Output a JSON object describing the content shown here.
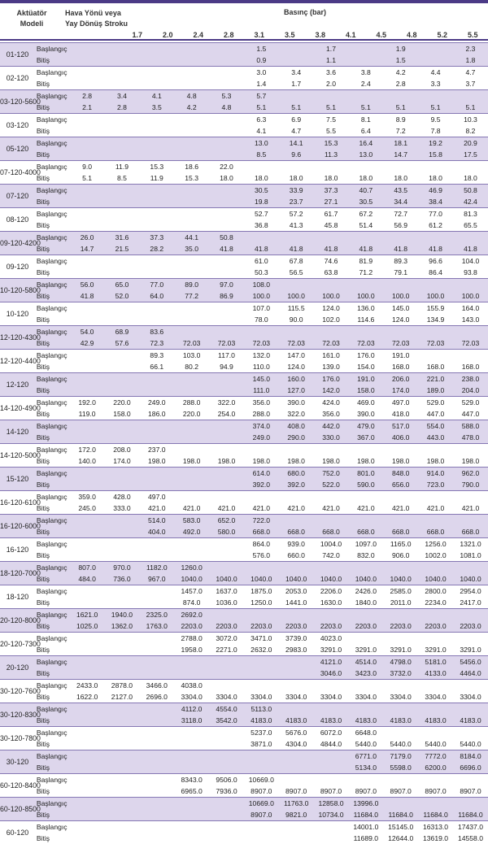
{
  "header": {
    "model_label_line1": "Aktüatör",
    "model_label_line2": "Modeli",
    "direction_line1": "Hava Yönü veya",
    "direction_line2": "Yay Dönüş Stroku",
    "pressure_label": "Basınç (bar)",
    "pressures": [
      "1.7",
      "2.0",
      "2.4",
      "2.8",
      "3.1",
      "3.5",
      "3.8",
      "4.1",
      "4.5",
      "4.8",
      "5.2",
      "5.5"
    ]
  },
  "start_label": "Başlangıç",
  "end_label": "Bitiş",
  "rows": [
    {
      "model": "01-120",
      "start": [
        "",
        "",
        "",
        "",
        "",
        "1.5",
        "",
        "1.7",
        "",
        "1.9",
        "",
        "2.3"
      ],
      "end": [
        "",
        "",
        "",
        "",
        "",
        "0.9",
        "",
        "1.1",
        "",
        "1.5",
        "",
        "1.8"
      ]
    },
    {
      "model": "02-120",
      "start": [
        "",
        "",
        "",
        "",
        "",
        "3.0",
        "3.4",
        "3.6",
        "3.8",
        "4.2",
        "4.4",
        "4.7"
      ],
      "end": [
        "",
        "",
        "",
        "",
        "",
        "1.4",
        "1.7",
        "2.0",
        "2.4",
        "2.8",
        "3.3",
        "3.7"
      ]
    },
    {
      "model": "03-120-5600",
      "start": [
        "2.8",
        "3.4",
        "4.1",
        "4.8",
        "5.3",
        "5.7",
        "",
        "",
        "",
        "",
        "",
        ""
      ],
      "end": [
        "2.1",
        "2.8",
        "3.5",
        "4.2",
        "4.8",
        "5.1",
        "5.1",
        "5.1",
        "5.1",
        "5.1",
        "5.1",
        "5.1"
      ]
    },
    {
      "model": "03-120",
      "start": [
        "",
        "",
        "",
        "",
        "",
        "6.3",
        "6.9",
        "7.5",
        "8.1",
        "8.9",
        "9.5",
        "10.3"
      ],
      "end": [
        "",
        "",
        "",
        "",
        "",
        "4.1",
        "4.7",
        "5.5",
        "6.4",
        "7.2",
        "7.8",
        "8.2"
      ]
    },
    {
      "model": "05-120",
      "start": [
        "",
        "",
        "",
        "",
        "",
        "13.0",
        "14.1",
        "15.3",
        "16.4",
        "18.1",
        "19.2",
        "20.9"
      ],
      "end": [
        "",
        "",
        "",
        "",
        "",
        "8.5",
        "9.6",
        "11.3",
        "13.0",
        "14.7",
        "15.8",
        "17.5"
      ]
    },
    {
      "model": "07-120-4000",
      "start": [
        "9.0",
        "11.9",
        "15.3",
        "18.6",
        "22.0",
        "",
        "",
        "",
        "",
        "",
        "",
        ""
      ],
      "end": [
        "5.1",
        "8.5",
        "11.9",
        "15.3",
        "18.0",
        "18.0",
        "18.0",
        "18.0",
        "18.0",
        "18.0",
        "18.0",
        "18.0"
      ]
    },
    {
      "model": "07-120",
      "start": [
        "",
        "",
        "",
        "",
        "",
        "30.5",
        "33.9",
        "37.3",
        "40.7",
        "43.5",
        "46.9",
        "50.8"
      ],
      "end": [
        "",
        "",
        "",
        "",
        "",
        "19.8",
        "23.7",
        "27.1",
        "30.5",
        "34.4",
        "38.4",
        "42.4"
      ]
    },
    {
      "model": "08-120",
      "start": [
        "",
        "",
        "",
        "",
        "",
        "52.7",
        "57.2",
        "61.7",
        "67.2",
        "72.7",
        "77.0",
        "81.3"
      ],
      "end": [
        "",
        "",
        "",
        "",
        "",
        "36.8",
        "41.3",
        "45.8",
        "51.4",
        "56.9",
        "61.2",
        "65.5"
      ]
    },
    {
      "model": "09-120-4200",
      "start": [
        "26.0",
        "31.6",
        "37.3",
        "44.1",
        "50.8",
        "",
        "",
        "",
        "",
        "",
        "",
        ""
      ],
      "end": [
        "14.7",
        "21.5",
        "28.2",
        "35.0",
        "41.8",
        "41.8",
        "41.8",
        "41.8",
        "41.8",
        "41.8",
        "41.8",
        "41.8"
      ]
    },
    {
      "model": "09-120",
      "start": [
        "",
        "",
        "",
        "",
        "",
        "61.0",
        "67.8",
        "74.6",
        "81.9",
        "89.3",
        "96.6",
        "104.0"
      ],
      "end": [
        "",
        "",
        "",
        "",
        "",
        "50.3",
        "56.5",
        "63.8",
        "71.2",
        "79.1",
        "86.4",
        "93.8"
      ]
    },
    {
      "model": "10-120-5800",
      "start": [
        "56.0",
        "65.0",
        "77.0",
        "89.0",
        "97.0",
        "108.0",
        "",
        "",
        "",
        "",
        "",
        ""
      ],
      "end": [
        "41.8",
        "52.0",
        "64.0",
        "77.2",
        "86.9",
        "100.0",
        "100.0",
        "100.0",
        "100.0",
        "100.0",
        "100.0",
        "100.0"
      ]
    },
    {
      "model": "10-120",
      "start": [
        "",
        "",
        "",
        "",
        "",
        "107.0",
        "115.5",
        "124.0",
        "136.0",
        "145.0",
        "155.9",
        "164.0"
      ],
      "end": [
        "",
        "",
        "",
        "",
        "",
        "78.0",
        "90.0",
        "102.0",
        "114.6",
        "124.0",
        "134.9",
        "143.0"
      ]
    },
    {
      "model": "12-120-4300",
      "start": [
        "54.0",
        "68.9",
        "83.6",
        "",
        "",
        "",
        "",
        "",
        "",
        "",
        "",
        ""
      ],
      "end": [
        "42.9",
        "57.6",
        "72.3",
        "72.03",
        "72.03",
        "72.03",
        "72.03",
        "72.03",
        "72.03",
        "72.03",
        "72.03",
        "72.03"
      ]
    },
    {
      "model": "12-120-4400",
      "start": [
        "",
        "",
        "89.3",
        "103.0",
        "117.0",
        "132.0",
        "147.0",
        "161.0",
        "176.0",
        "191.0",
        "",
        ""
      ],
      "end": [
        "",
        "",
        "66.1",
        "80.2",
        "94.9",
        "110.0",
        "124.0",
        "139.0",
        "154.0",
        "168.0",
        "168.0",
        "168.0"
      ]
    },
    {
      "model": "12-120",
      "start": [
        "",
        "",
        "",
        "",
        "",
        "145.0",
        "160.0",
        "176.0",
        "191.0",
        "206.0",
        "221.0",
        "238.0"
      ],
      "end": [
        "",
        "",
        "",
        "",
        "",
        "111.0",
        "127.0",
        "142.0",
        "158.0",
        "174.0",
        "189.0",
        "204.0"
      ]
    },
    {
      "model": "14-120-4900",
      "start": [
        "192.0",
        "220.0",
        "249.0",
        "288.0",
        "322.0",
        "356.0",
        "390.0",
        "424.0",
        "469.0",
        "497.0",
        "529.0",
        "529.0"
      ],
      "end": [
        "119.0",
        "158.0",
        "186.0",
        "220.0",
        "254.0",
        "288.0",
        "322.0",
        "356.0",
        "390.0",
        "418.0",
        "447.0",
        "447.0"
      ]
    },
    {
      "model": "14-120",
      "start": [
        "",
        "",
        "",
        "",
        "",
        "374.0",
        "408.0",
        "442.0",
        "479.0",
        "517.0",
        "554.0",
        "588.0"
      ],
      "end": [
        "",
        "",
        "",
        "",
        "",
        "249.0",
        "290.0",
        "330.0",
        "367.0",
        "406.0",
        "443.0",
        "478.0"
      ]
    },
    {
      "model": "14-120-5000",
      "start": [
        "172.0",
        "208.0",
        "237.0",
        "",
        "",
        "",
        "",
        "",
        "",
        "",
        "",
        ""
      ],
      "end": [
        "140.0",
        "174.0",
        "198.0",
        "198.0",
        "198.0",
        "198.0",
        "198.0",
        "198.0",
        "198.0",
        "198.0",
        "198.0",
        "198.0"
      ]
    },
    {
      "model": "15-120",
      "start": [
        "",
        "",
        "",
        "",
        "",
        "614.0",
        "680.0",
        "752.0",
        "801.0",
        "848.0",
        "914.0",
        "962.0"
      ],
      "end": [
        "",
        "",
        "",
        "",
        "",
        "392.0",
        "392.0",
        "522.0",
        "590.0",
        "656.0",
        "723.0",
        "790.0"
      ]
    },
    {
      "model": "16-120-6100",
      "start": [
        "359.0",
        "428.0",
        "497.0",
        "",
        "",
        "",
        "",
        "",
        "",
        "",
        "",
        ""
      ],
      "end": [
        "245.0",
        "333.0",
        "421.0",
        "421.0",
        "421.0",
        "421.0",
        "421.0",
        "421.0",
        "421.0",
        "421.0",
        "421.0",
        "421.0"
      ]
    },
    {
      "model": "16-120-6000",
      "start": [
        "",
        "",
        "514.0",
        "583.0",
        "652.0",
        "722.0",
        "",
        "",
        "",
        "",
        "",
        ""
      ],
      "end": [
        "",
        "",
        "404.0",
        "492.0",
        "580.0",
        "668.0",
        "668.0",
        "668.0",
        "668.0",
        "668.0",
        "668.0",
        "668.0"
      ]
    },
    {
      "model": "16-120",
      "start": [
        "",
        "",
        "",
        "",
        "",
        "864.0",
        "939.0",
        "1004.0",
        "1097.0",
        "1165.0",
        "1256.0",
        "1321.0"
      ],
      "end": [
        "",
        "",
        "",
        "",
        "",
        "576.0",
        "660.0",
        "742.0",
        "832.0",
        "906.0",
        "1002.0",
        "1081.0"
      ]
    },
    {
      "model": "18-120-7000",
      "start": [
        "807.0",
        "970.0",
        "1182.0",
        "1260.0",
        "",
        "",
        "",
        "",
        "",
        "",
        "",
        ""
      ],
      "end": [
        "484.0",
        "736.0",
        "967.0",
        "1040.0",
        "1040.0",
        "1040.0",
        "1040.0",
        "1040.0",
        "1040.0",
        "1040.0",
        "1040.0",
        "1040.0"
      ]
    },
    {
      "model": "18-120",
      "start": [
        "",
        "",
        "",
        "1457.0",
        "1637.0",
        "1875.0",
        "2053.0",
        "2206.0",
        "2426.0",
        "2585.0",
        "2800.0",
        "2954.0"
      ],
      "end": [
        "",
        "",
        "",
        "874.0",
        "1036.0",
        "1250.0",
        "1441.0",
        "1630.0",
        "1840.0",
        "2011.0",
        "2234.0",
        "2417.0"
      ]
    },
    {
      "model": "20-120-8000",
      "start": [
        "1621.0",
        "1940.0",
        "2325.0",
        "2692.0",
        "",
        "",
        "",
        "",
        "",
        "",
        "",
        ""
      ],
      "end": [
        "1025.0",
        "1362.0",
        "1763.0",
        "2203.0",
        "2203.0",
        "2203.0",
        "2203.0",
        "2203.0",
        "2203.0",
        "2203.0",
        "2203.0",
        "2203.0"
      ]
    },
    {
      "model": "20-120-7300",
      "start": [
        "",
        "",
        "",
        "2788.0",
        "3072.0",
        "3471.0",
        "3739.0",
        "4023.0",
        "",
        "",
        "",
        ""
      ],
      "end": [
        "",
        "",
        "",
        "1958.0",
        "2271.0",
        "2632.0",
        "2983.0",
        "3291.0",
        "3291.0",
        "3291.0",
        "3291.0",
        "3291.0"
      ]
    },
    {
      "model": "20-120",
      "start": [
        "",
        "",
        "",
        "",
        "",
        "",
        "",
        "4121.0",
        "4514.0",
        "4798.0",
        "5181.0",
        "5456.0"
      ],
      "end": [
        "",
        "",
        "",
        "",
        "",
        "",
        "",
        "3046.0",
        "3423.0",
        "3732.0",
        "4133.0",
        "4464.0"
      ]
    },
    {
      "model": "30-120-7600",
      "start": [
        "2433.0",
        "2878.0",
        "3466.0",
        "4038.0",
        "",
        "",
        "",
        "",
        "",
        "",
        "",
        ""
      ],
      "end": [
        "1622.0",
        "2127.0",
        "2696.0",
        "3304.0",
        "3304.0",
        "3304.0",
        "3304.0",
        "3304.0",
        "3304.0",
        "3304.0",
        "3304.0",
        "3304.0"
      ]
    },
    {
      "model": "30-120-8300",
      "start": [
        "",
        "",
        "",
        "4112.0",
        "4554.0",
        "5113.0",
        "",
        "",
        "",
        "",
        "",
        ""
      ],
      "end": [
        "",
        "",
        "",
        "3118.0",
        "3542.0",
        "4183.0",
        "4183.0",
        "4183.0",
        "4183.0",
        "4183.0",
        "4183.0",
        "4183.0"
      ]
    },
    {
      "model": "30-120-7800",
      "start": [
        "",
        "",
        "",
        "",
        "",
        "5237.0",
        "5676.0",
        "6072.0",
        "6648.0",
        "",
        "",
        ""
      ],
      "end": [
        "",
        "",
        "",
        "",
        "",
        "3871.0",
        "4304.0",
        "4844.0",
        "5440.0",
        "5440.0",
        "5440.0",
        "5440.0"
      ]
    },
    {
      "model": "30-120",
      "start": [
        "",
        "",
        "",
        "",
        "",
        "",
        "",
        "",
        "6771.0",
        "7179.0",
        "7772.0",
        "8184.0"
      ],
      "end": [
        "",
        "",
        "",
        "",
        "",
        "",
        "",
        "",
        "5134.0",
        "5598.0",
        "6200.0",
        "6696.0"
      ]
    },
    {
      "model": "60-120-8400",
      "start": [
        "",
        "",
        "",
        "8343.0",
        "9506.0",
        "10669.0",
        "",
        "",
        "",
        "",
        "",
        ""
      ],
      "end": [
        "",
        "",
        "",
        "6965.0",
        "7936.0",
        "8907.0",
        "8907.0",
        "8907.0",
        "8907.0",
        "8907.0",
        "8907.0",
        "8907.0"
      ]
    },
    {
      "model": "60-120-8500",
      "start": [
        "",
        "",
        "",
        "",
        "",
        "10669.0",
        "11763.0",
        "12858.0",
        "13996.0",
        "",
        "",
        ""
      ],
      "end": [
        "",
        "",
        "",
        "",
        "",
        "8907.0",
        "9821.0",
        "10734.0",
        "11684.0",
        "11684.0",
        "11684.0",
        "11684.0"
      ]
    },
    {
      "model": "60-120",
      "start": [
        "",
        "",
        "",
        "",
        "",
        "",
        "",
        "",
        "14001.0",
        "15145.0",
        "16313.0",
        "17437.0"
      ],
      "end": [
        "",
        "",
        "",
        "",
        "",
        "",
        "",
        "",
        "11689.0",
        "12644.0",
        "13619.0",
        "14558.0"
      ]
    }
  ]
}
